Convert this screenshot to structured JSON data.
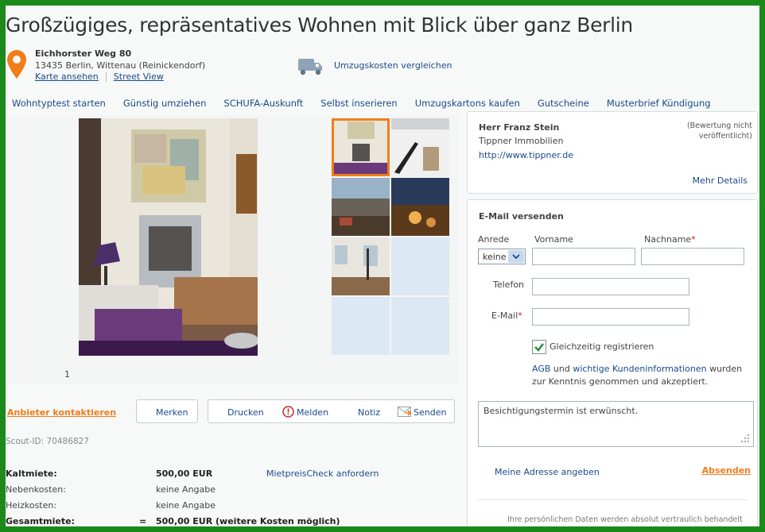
{
  "listing": {
    "title": "Großzügiges, repräsentatives Wohnen mit Blick über ganz Berlin",
    "street": "Eichhorster Weg 80",
    "city": "13435 Berlin, Wittenau (Reinickendorf)",
    "map_link": "Karte ansehen",
    "streetview_link": "Street View",
    "moving_cost_link": "Umzugskosten vergleichen",
    "scout_id": "Scout-ID: 70486827",
    "photo_counter": "1"
  },
  "nav": {
    "items": [
      "Wohntyptest starten",
      "Günstig umziehen",
      "SCHUFA-Auskunft",
      "Selbst inserieren",
      "Umzugskartons kaufen",
      "Gutscheine",
      "Musterbrief Kündigung"
    ]
  },
  "actions": {
    "contact": "Anbieter kontaktieren",
    "remember": "Merken",
    "print": "Drucken",
    "report": "Melden",
    "note": "Notiz",
    "send": "Senden"
  },
  "costs": {
    "cold_label": "Kaltmiete:",
    "cold_value": "500,00 EUR",
    "check_link": "MietpreisCheck anfordern",
    "extra_label": "Nebenkosten:",
    "extra_value": "keine Angabe",
    "heating_label": "Heizkosten:",
    "heating_value": "keine Angabe",
    "total_label": "Gesamtmiete:",
    "total_eq": "=",
    "total_value": "500,00 EUR (weitere Kosten möglich)"
  },
  "agent": {
    "name": "Herr Franz Stein",
    "company": "Tippner Immobilien",
    "website": "http://www.tippner.de",
    "rating_line1": "(Bewertung nicht",
    "rating_line2": "veröffentlicht)",
    "details_link": "Mehr Details"
  },
  "email_form": {
    "heading": "E-Mail versenden",
    "salutation_label": "Anrede",
    "salutation_value": "keine",
    "firstname_label": "Vorname",
    "lastname_label": "Nachname",
    "required_mark": "*",
    "phone_label": "Telefon",
    "email_label": "E-Mail",
    "register_label": "Gleichzeitig registrieren",
    "terms_agb": "AGB",
    "terms_and": " und ",
    "terms_info": "wichtige Kundeninformationen",
    "terms_rest1": " wurden",
    "terms_rest2": "zur Kenntnis genommen und akzeptiert.",
    "message": "Besichtigungstermin ist erwünscht.",
    "address_link": "Meine Adresse angeben",
    "submit": "Absenden",
    "privacy_line1": "Ihre persönlichen Daten werden absolut vertraulich behandelt"
  },
  "colors": {
    "accent": "#f07d1a",
    "link": "#1a4a8a",
    "frame": "#1a8a1a"
  }
}
